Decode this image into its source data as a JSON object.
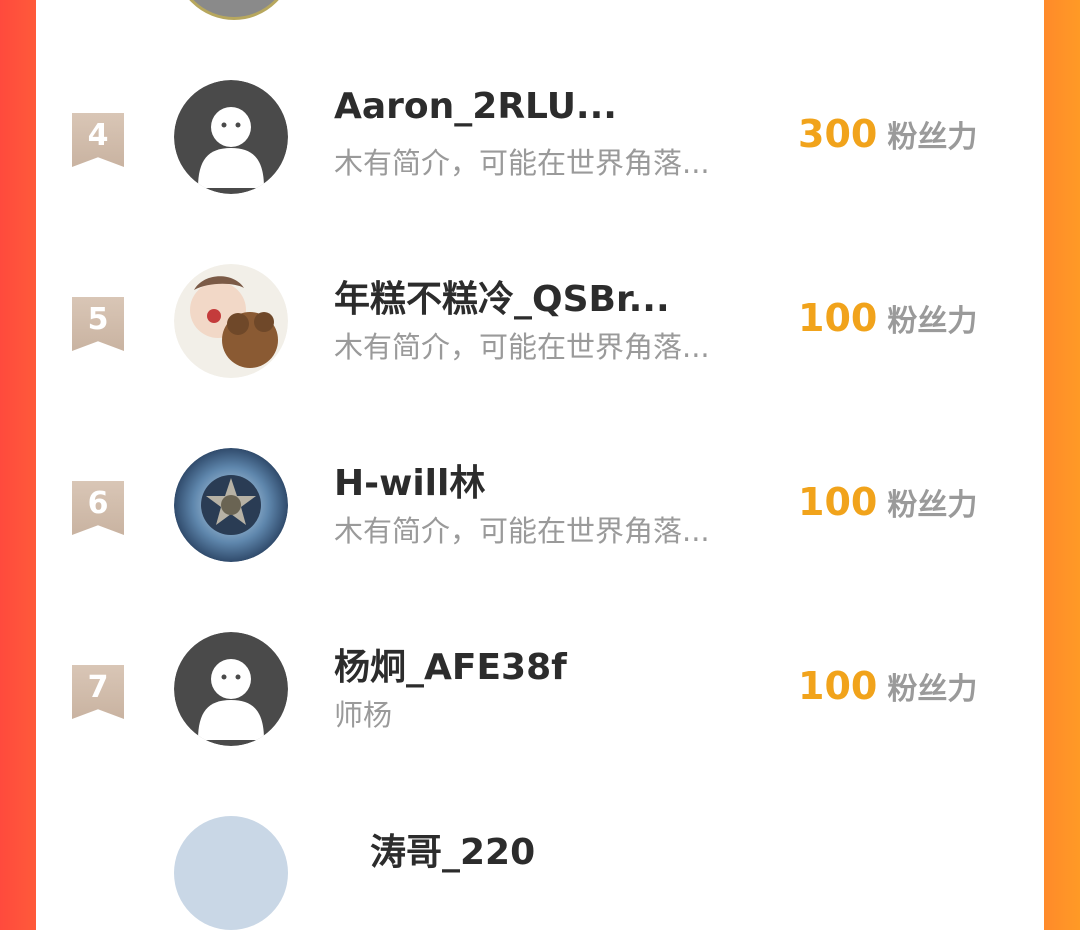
{
  "rows": [
    {
      "rank": "4",
      "name": "Aaron_2RLU...",
      "bio": "木有简介，可能在世界角落...",
      "score": "300",
      "unit": "粉丝力",
      "avatar": "default-avatar-icon"
    },
    {
      "rank": "5",
      "name": "年糕不糕冷_QSBr...",
      "bio": "木有简介，可能在世界角落...",
      "score": "100",
      "unit": "粉丝力",
      "avatar": "child-with-teddy-photo"
    },
    {
      "rank": "6",
      "name": "H-will林",
      "bio": "木有简介，可能在世界角落...",
      "score": "100",
      "unit": "粉丝力",
      "avatar": "soccer-ball-stars-image"
    },
    {
      "rank": "7",
      "name": "杨炯_AFE38f",
      "bio": "师杨",
      "score": "100",
      "unit": "粉丝力",
      "avatar": "default-avatar-icon"
    }
  ],
  "partial_next_name": "涛哥_220",
  "colors": {
    "accent": "#f1a31b",
    "left_edge": "#ff4a3d",
    "right_edge": "#ff9a26",
    "badge": "#d4bfae"
  }
}
